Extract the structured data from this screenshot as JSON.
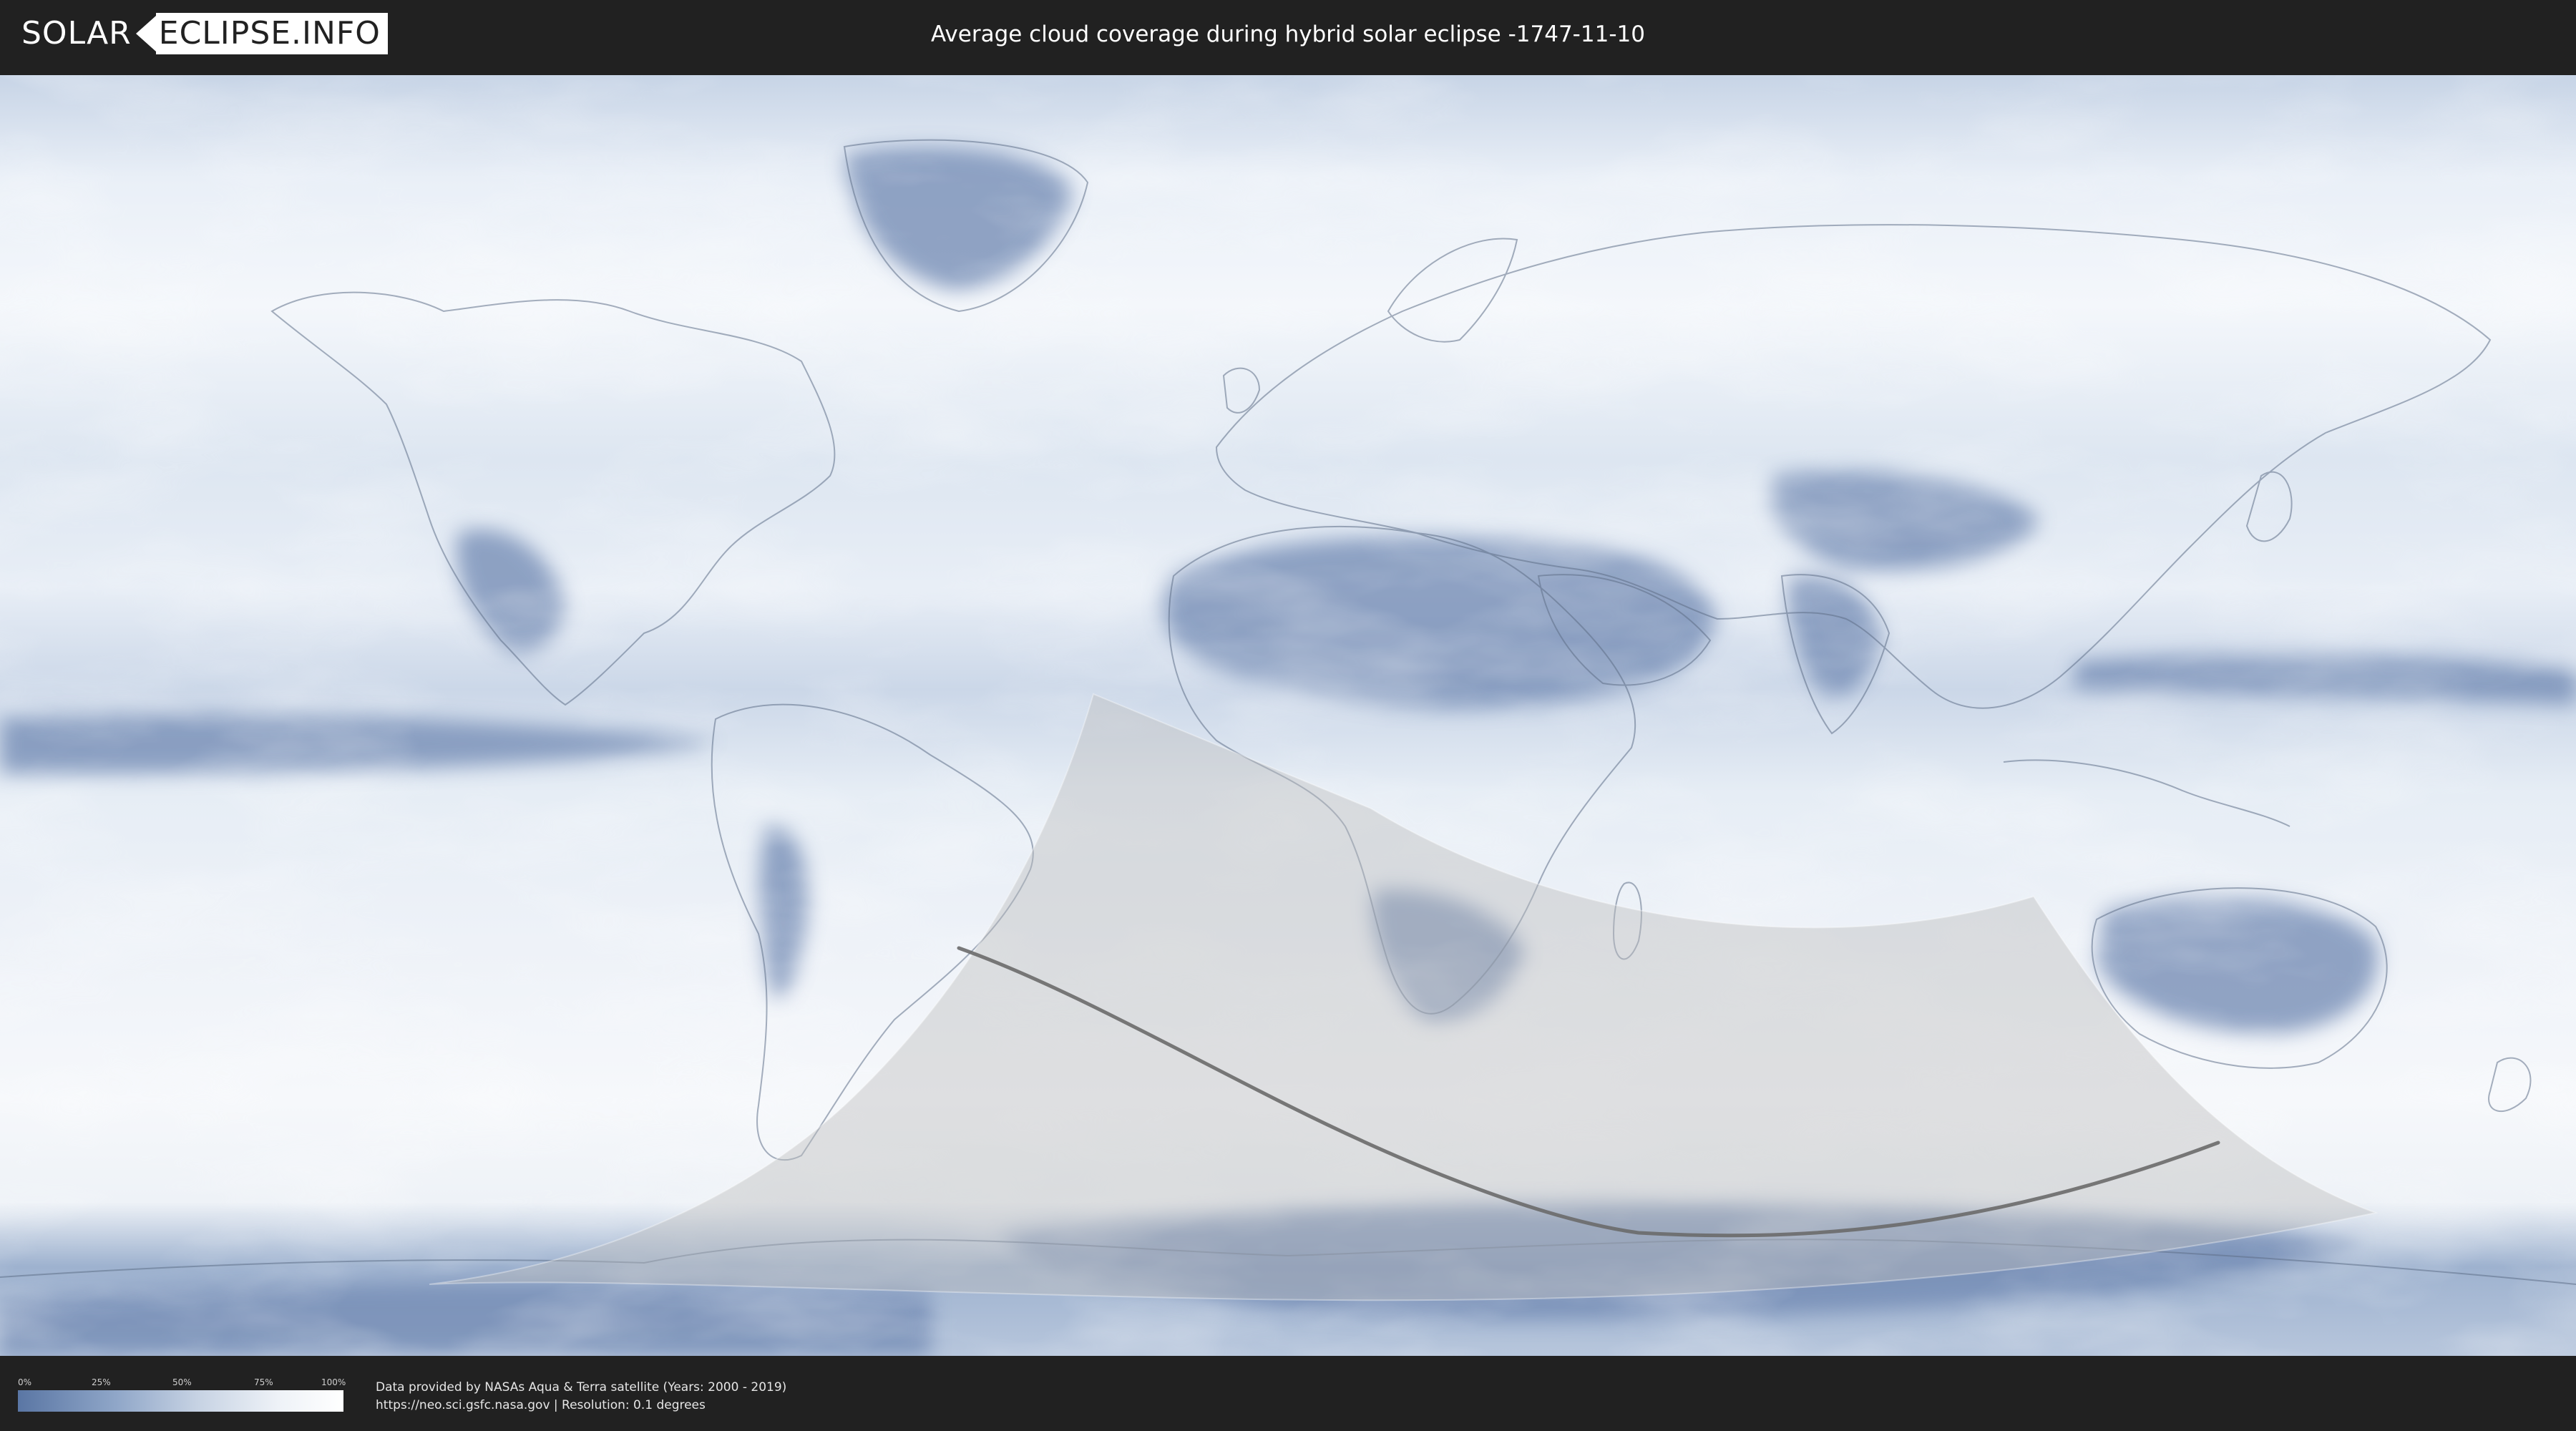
{
  "header": {
    "logo_left": "SOLAR",
    "logo_right": "ECLIPSE.INFO",
    "title": "Average cloud coverage during hybrid solar eclipse -1747-11-10"
  },
  "legend": {
    "ticks": [
      "0%",
      "25%",
      "50%",
      "75%",
      "100%"
    ],
    "low_color": "#5a76a4",
    "high_color": "#ffffff"
  },
  "credit": {
    "line1": "Data provided by NASAs Aqua & Terra satellite (Years: 2000 - 2019)",
    "line2": "https://neo.sci.gsfc.nasa.gov | Resolution: 0.1 degrees"
  },
  "colors": {
    "background": "#212121",
    "cloud_clear": "#5a76a4",
    "cloud_overcast": "#ffffff",
    "eclipse_overlay": "#bdbdbd",
    "central_line": "#6a6a6a"
  },
  "map": {
    "projection": "equirectangular",
    "layers": [
      "cloud-coverage",
      "country-borders",
      "eclipse-visibility-zone",
      "central-line"
    ]
  }
}
